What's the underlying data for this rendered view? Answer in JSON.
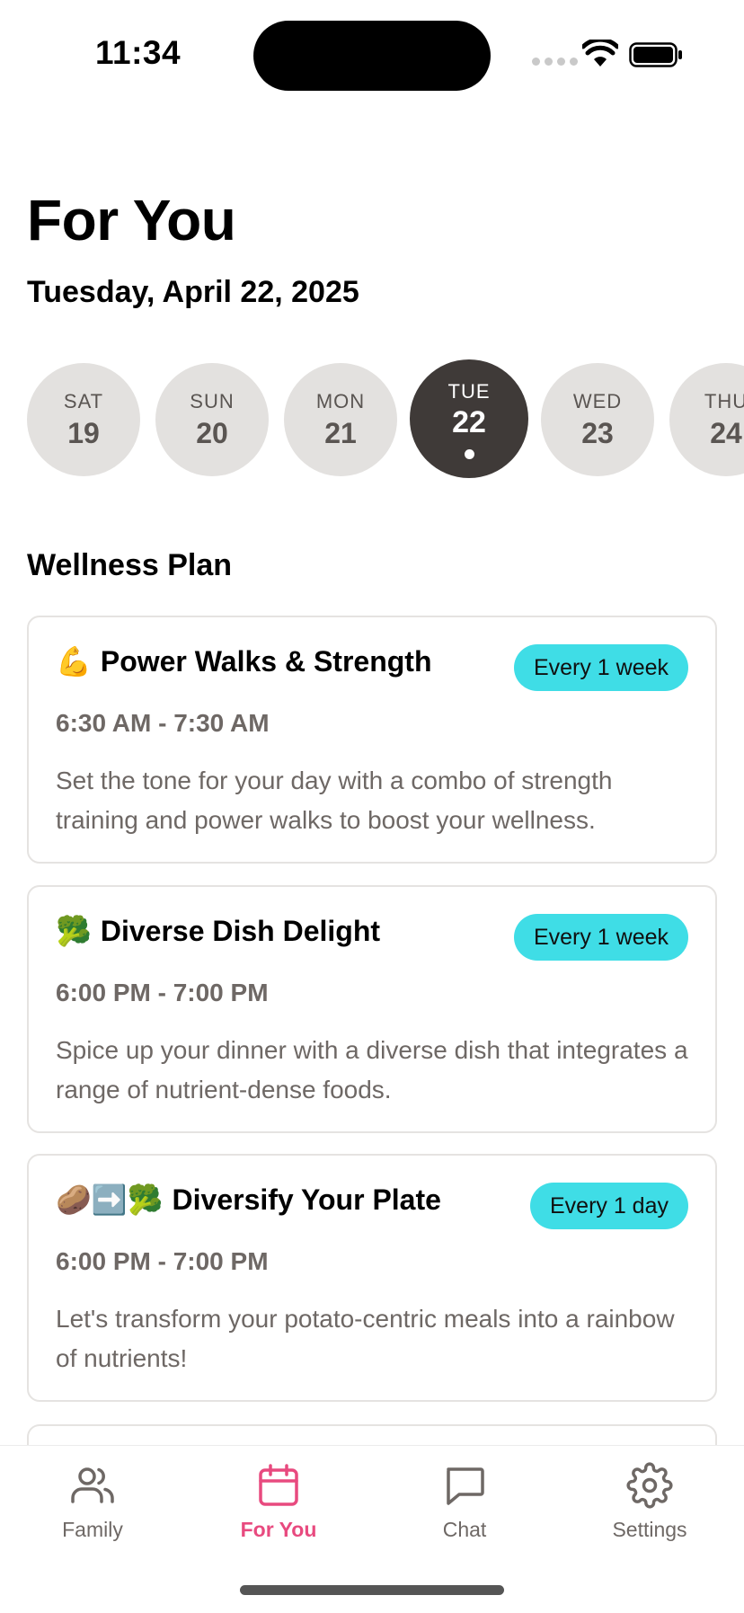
{
  "status_bar": {
    "time": "11:34"
  },
  "header": {
    "title": "For You",
    "date": "Tuesday, April 22, 2025"
  },
  "days": [
    {
      "dow": "SAT",
      "num": "19",
      "selected": false
    },
    {
      "dow": "SUN",
      "num": "20",
      "selected": false
    },
    {
      "dow": "MON",
      "num": "21",
      "selected": false
    },
    {
      "dow": "TUE",
      "num": "22",
      "selected": true
    },
    {
      "dow": "WED",
      "num": "23",
      "selected": false
    },
    {
      "dow": "THU",
      "num": "24",
      "selected": false
    }
  ],
  "section": {
    "title": "Wellness Plan"
  },
  "cards": [
    {
      "emoji": "💪",
      "title": "Power Walks & Strength",
      "badge": "Every 1 week",
      "time": "6:30 AM - 7:30 AM",
      "description": "Set the tone for your day with a combo of strength training and power walks to boost your wellness."
    },
    {
      "emoji": "🥦",
      "title": "Diverse Dish Delight",
      "badge": "Every 1 week",
      "time": "6:00 PM - 7:00 PM",
      "description": "Spice up your dinner with a diverse dish that integrates a range of nutrient-dense foods."
    },
    {
      "emoji": "🥔➡️🥦",
      "title": "Diversify Your Plate",
      "badge": "Every 1 day",
      "time": "6:00 PM - 7:00 PM",
      "description": "Let's transform your potato-centric meals into a rainbow of nutrients!"
    }
  ],
  "tabs": [
    {
      "label": "Family",
      "icon": "users-icon",
      "active": false
    },
    {
      "label": "For You",
      "icon": "calendar-icon",
      "active": true
    },
    {
      "label": "Chat",
      "icon": "chat-bubble-icon",
      "active": false
    },
    {
      "label": "Settings",
      "icon": "gear-icon",
      "active": false
    }
  ],
  "colors": {
    "accent": "#e84a7f",
    "badge": "#3fdde6",
    "selected_day": "#3f3a38",
    "day_bg": "#e3e1df",
    "muted_text": "#6e6865"
  }
}
